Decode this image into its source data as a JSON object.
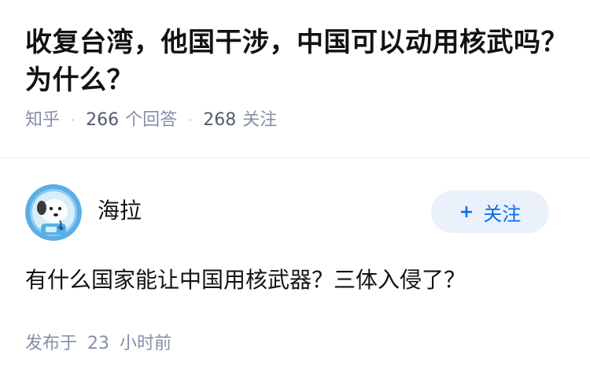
{
  "question": {
    "title": "收复台湾，他国干涉，中国可以动用核武吗？为什么？",
    "source": "知乎",
    "answer_count": "266",
    "answer_label": "个回答",
    "follow_count": "268",
    "follow_label": "关注"
  },
  "answer": {
    "author_name": "海拉",
    "follow_button_label": "关注",
    "content": "有什么国家能让中国用核武器？三体入侵了？",
    "publish_prefix": "发布于",
    "publish_value": "23",
    "publish_suffix": "小时前"
  },
  "colors": {
    "accent": "#056de8",
    "accent_bg": "#eaf1fb",
    "meta_text": "#8590a6",
    "avatar_bg": "#5aaee6"
  },
  "icons": {
    "avatar": "dog-astronaut-avatar",
    "follow": "plus-icon"
  }
}
